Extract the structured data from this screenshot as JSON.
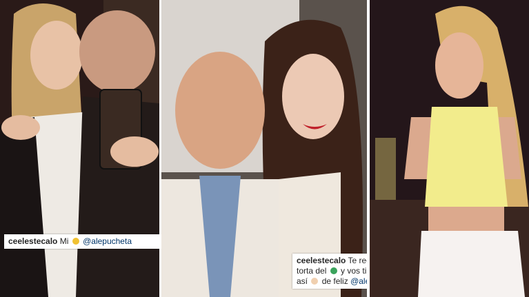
{
  "panels": [
    {
      "id": "left-photo",
      "subject": "couple-kissing-selfie"
    },
    {
      "id": "center-photo",
      "subject": "couple-smiling-portrait"
    },
    {
      "id": "right-photo",
      "subject": "woman-yellow-top"
    }
  ],
  "caption_left": {
    "username": "ceelestecalo",
    "text": "Mi",
    "mention": "@alepucheta",
    "emoji": "pineapple-icon"
  },
  "caption_center": {
    "username": "ceelestecalo",
    "text_1": "Te regalan la mejor torta del",
    "text_2": "y vos tipo.. Me hacés así",
    "text_3": "de feliz",
    "mention": "@alepucheta",
    "emoji_1": "globe-icon",
    "emoji_2": "pointing-hand-icon",
    "emoji_3": "purple-heart-icon"
  },
  "colors": {
    "mention": "#003569",
    "heart": "#8e44ad"
  }
}
